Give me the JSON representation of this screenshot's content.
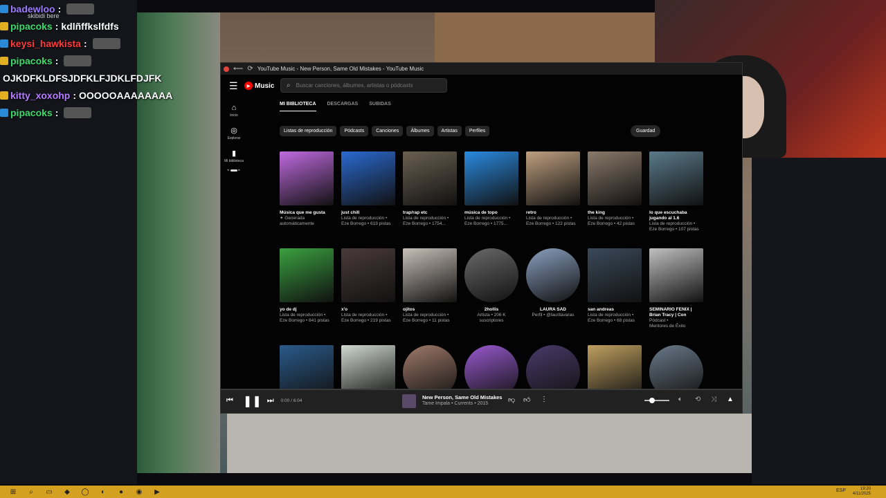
{
  "chat": {
    "lines": [
      {
        "user": "badewloo",
        "sep": ":",
        "msg": "",
        "color": "#9b7bff"
      },
      {
        "user": "pipacoks",
        "sep": ":",
        "msg": "kdlñffkslfdfs",
        "color": "#3adc6a"
      },
      {
        "user": "keysi_hawkista",
        "sep": ":",
        "msg": "",
        "color": "#ff3a3a"
      },
      {
        "user": "pipacoks",
        "sep": ":",
        "msg": "",
        "color": "#3adc6a"
      },
      {
        "user": "",
        "sep": "",
        "msg": "OJKDFKLDFSJDFKLFJDKLFDJFK",
        "color": "#ffffff"
      },
      {
        "user": "kitty_xoxohp",
        "sep": ":",
        "msg": "OOOOOAAAAAAAA",
        "color": "#b57bff"
      },
      {
        "user": "pipacoks",
        "sep": ":",
        "msg": "",
        "color": "#3adc6a"
      }
    ],
    "note": "skibidi bere"
  },
  "window": {
    "title": "YouTube Music - New Person, Same Old Mistakes - YouTube Music"
  },
  "header": {
    "logo_text": "Music",
    "search_placeholder": "Buscar canciones, álbumes, artistas o pódcasts"
  },
  "sidebar": [
    {
      "label": "Inicio",
      "icon": "home-icon"
    },
    {
      "label": "Explorar",
      "icon": "compass-icon"
    },
    {
      "label": "Mi biblioteca",
      "icon": "library-icon"
    }
  ],
  "tabs": [
    "MI BIBLIOTECA",
    "DESCARGAS",
    "SUBIDAS"
  ],
  "chips": [
    "Listas de reproducción",
    "Pódcasts",
    "Canciones",
    "Álbumes",
    "Artistas",
    "Perfiles"
  ],
  "sort_label": "Guardad",
  "library": [
    [
      {
        "title": "Música que me gusta",
        "sub": [
          "✦ Generada",
          "automáticamente"
        ],
        "color": "#c06ae0"
      },
      {
        "title": "just chill",
        "sub": [
          "Lista de reproducción •",
          "Eze Borrego • 619 pistas"
        ],
        "color": "#2a6ad0"
      },
      {
        "title": "trap/rap etc",
        "sub": [
          "Lista de reproducción •",
          "Eze Borrego • 1754..."
        ],
        "color": "#6a6050"
      },
      {
        "title": "música de topo",
        "sub": [
          "Lista de reproducción •",
          "Eze Borrego • 1775..."
        ],
        "color": "#2a8ae0"
      },
      {
        "title": "retro",
        "sub": [
          "Lista de reproducción •",
          "Eze Borrego • 122 pistas"
        ],
        "color": "#c0a080"
      },
      {
        "title": "the king",
        "sub": [
          "Lista de reproducción •",
          "Eze Borrego • 42 pistas"
        ],
        "color": "#8a7a6a"
      },
      {
        "title": "lo que escuchaba jugando al 1.6",
        "sub": [
          "Lista de reproducción •",
          "Eze Borrego • 107 pistas"
        ],
        "color": "#5a7a8a"
      }
    ],
    [
      {
        "title": "yo de dj",
        "sub": [
          "Lista de reproducción •",
          "Eze Borrego • 841 pistas"
        ],
        "color": "#3aa040"
      },
      {
        "title": "x'o",
        "sub": [
          "Lista de reproducción •",
          "Eze Borrego • 219 pistas"
        ],
        "color": "#4a3a3a"
      },
      {
        "title": "ojitos",
        "sub": [
          "Lista de reproducción •",
          "Eze Borrego • 11 pistas"
        ],
        "color": "#c8c0b8"
      },
      {
        "title": "2hollis",
        "sub": [
          "Artista • 206 K",
          "suscriptores"
        ],
        "color": "#6a6a6a",
        "round": true,
        "center": true
      },
      {
        "title": "LAURA SAD",
        "sub": [
          "Perfil • @lauritavaras"
        ],
        "color": "#8aa0c0",
        "round": true,
        "center": true
      },
      {
        "title": "san andreas",
        "sub": [
          "Lista de reproducción •",
          "Eze Borrego • 68 pistas"
        ],
        "color": "#3a4a5a"
      },
      {
        "title": "SEMINARIO FENIX | Brian Tracy | Con",
        "sub": [
          "Pódcast •",
          "Mentores de Éxito"
        ],
        "color": "#c0c0c0"
      }
    ],
    [
      {
        "title": "",
        "sub": [],
        "color": "#2a5a8a"
      },
      {
        "title": "",
        "sub": [],
        "color": "#d0d8d0"
      },
      {
        "title": "",
        "sub": [],
        "color": "#a07a6a",
        "round": true
      },
      {
        "title": "",
        "sub": [],
        "color": "#9a5ad0",
        "round": true
      },
      {
        "title": "",
        "sub": [],
        "color": "#4a3a6a",
        "round": true
      },
      {
        "title": "",
        "sub": [],
        "color": "#c0a060"
      },
      {
        "title": "",
        "sub": [],
        "color": "#6a7a8a",
        "round": true
      }
    ]
  ],
  "player": {
    "time": "0:00 / 6:04",
    "progress": 0,
    "song": "New Person, Same Old Mistakes",
    "subtitle": "Tame Impala • Currents • 2015",
    "volume": 0.3
  },
  "taskbar": {
    "time": "19:20",
    "date": "4/11/2025",
    "lang": "ESP"
  }
}
